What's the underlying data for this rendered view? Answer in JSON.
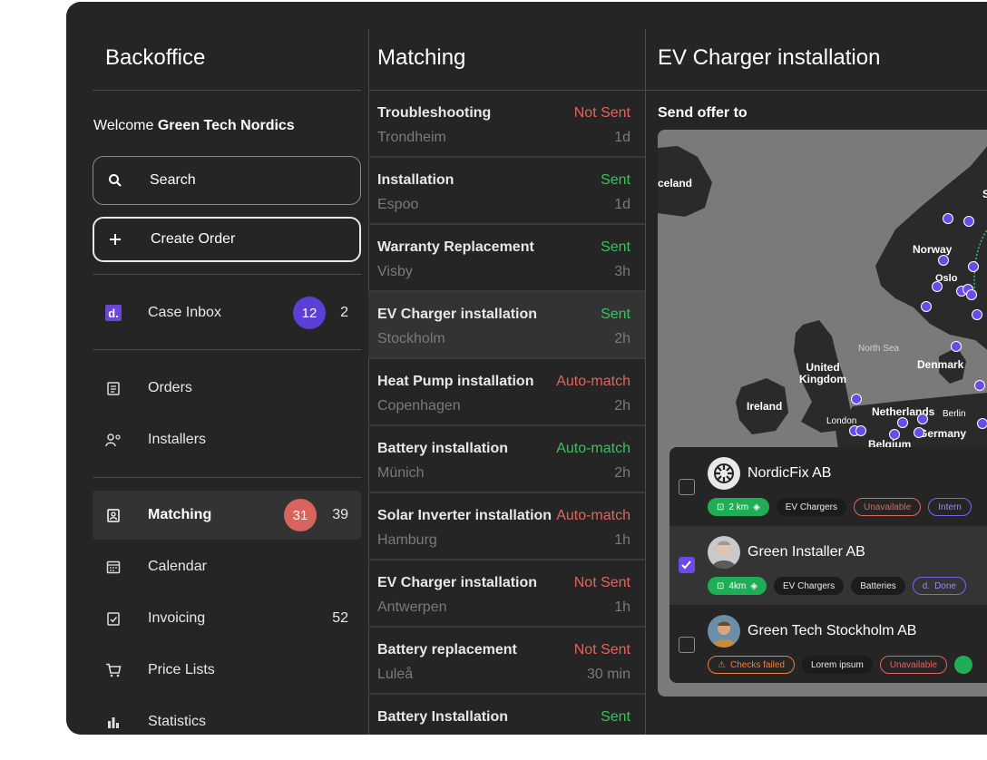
{
  "sidebar": {
    "title": "Backoffice",
    "welcome_prefix": "Welcome",
    "welcome_name": "Green Tech Nordics",
    "search_label": "Search",
    "create_label": "Create Order",
    "case_inbox": {
      "label": "Case Inbox",
      "badge": "12",
      "count": "2"
    },
    "orders": "Orders",
    "installers": "Installers",
    "matching": {
      "label": "Matching",
      "badge": "31",
      "count": "39"
    },
    "calendar": "Calendar",
    "invoicing": {
      "label": "Invoicing",
      "count": "52"
    },
    "price_lists": "Price Lists",
    "statistics": "Statistics",
    "colors": {
      "inbox_badge": "#5b3fd6",
      "matching_badge": "#d9645e"
    }
  },
  "matching": {
    "title": "Matching",
    "rows": [
      {
        "title": "Troubleshooting",
        "status": "Not Sent",
        "city": "Trondheim",
        "time": "1d"
      },
      {
        "title": "Installation",
        "status": "Sent",
        "city": "Espoo",
        "time": "1d"
      },
      {
        "title": "Warranty Replacement",
        "status": "Sent",
        "city": "Visby",
        "time": "3h"
      },
      {
        "title": "EV Charger installation",
        "status": "Sent",
        "city": "Stockholm",
        "time": "2h"
      },
      {
        "title": "Heat Pump installation",
        "status": "Auto-match",
        "city": "Copenhagen",
        "time": "2h"
      },
      {
        "title": "Battery installation",
        "status": "Auto-match",
        "city": "Münich",
        "time": "2h"
      },
      {
        "title": "Solar Inverter installation",
        "status": "Auto-match",
        "city": "Hamburg",
        "time": "1h"
      },
      {
        "title": "EV Charger installation",
        "status": "Not Sent",
        "city": "Antwerpen",
        "time": "1h"
      },
      {
        "title": "Battery replacement",
        "status": "Not Sent",
        "city": "Luleå",
        "time": "30 min"
      },
      {
        "title": "Battery Installation",
        "status": "Sent",
        "city": "",
        "time": ""
      }
    ]
  },
  "detail": {
    "title": "EV Charger installation",
    "send_offer": "Send offer to",
    "map_labels": {
      "iceland": "celand",
      "norway": "Norway",
      "oslo": "Oslo",
      "north_sea": "North Sea",
      "denmark": "Denmark",
      "uk": "United Kingdom",
      "ireland": "Ireland",
      "london": "London",
      "netherlands": "Netherlands",
      "berlin": "Berlin",
      "germany": "Germany",
      "belgium": "Belgium",
      "s": "S"
    },
    "installers": [
      {
        "name": "NordicFix AB",
        "distance": "2 km",
        "tags": [
          "EV Chargers",
          "Unavailable",
          "Intern"
        ]
      },
      {
        "name": "Green Installer AB",
        "distance": "4km",
        "tags": [
          "EV Chargers",
          "Batteries",
          "Done"
        ]
      },
      {
        "name": "Green Tech Stockholm AB",
        "tags": [
          "Checks failed",
          "Lorem ipsum",
          "Unavailable"
        ]
      }
    ]
  }
}
